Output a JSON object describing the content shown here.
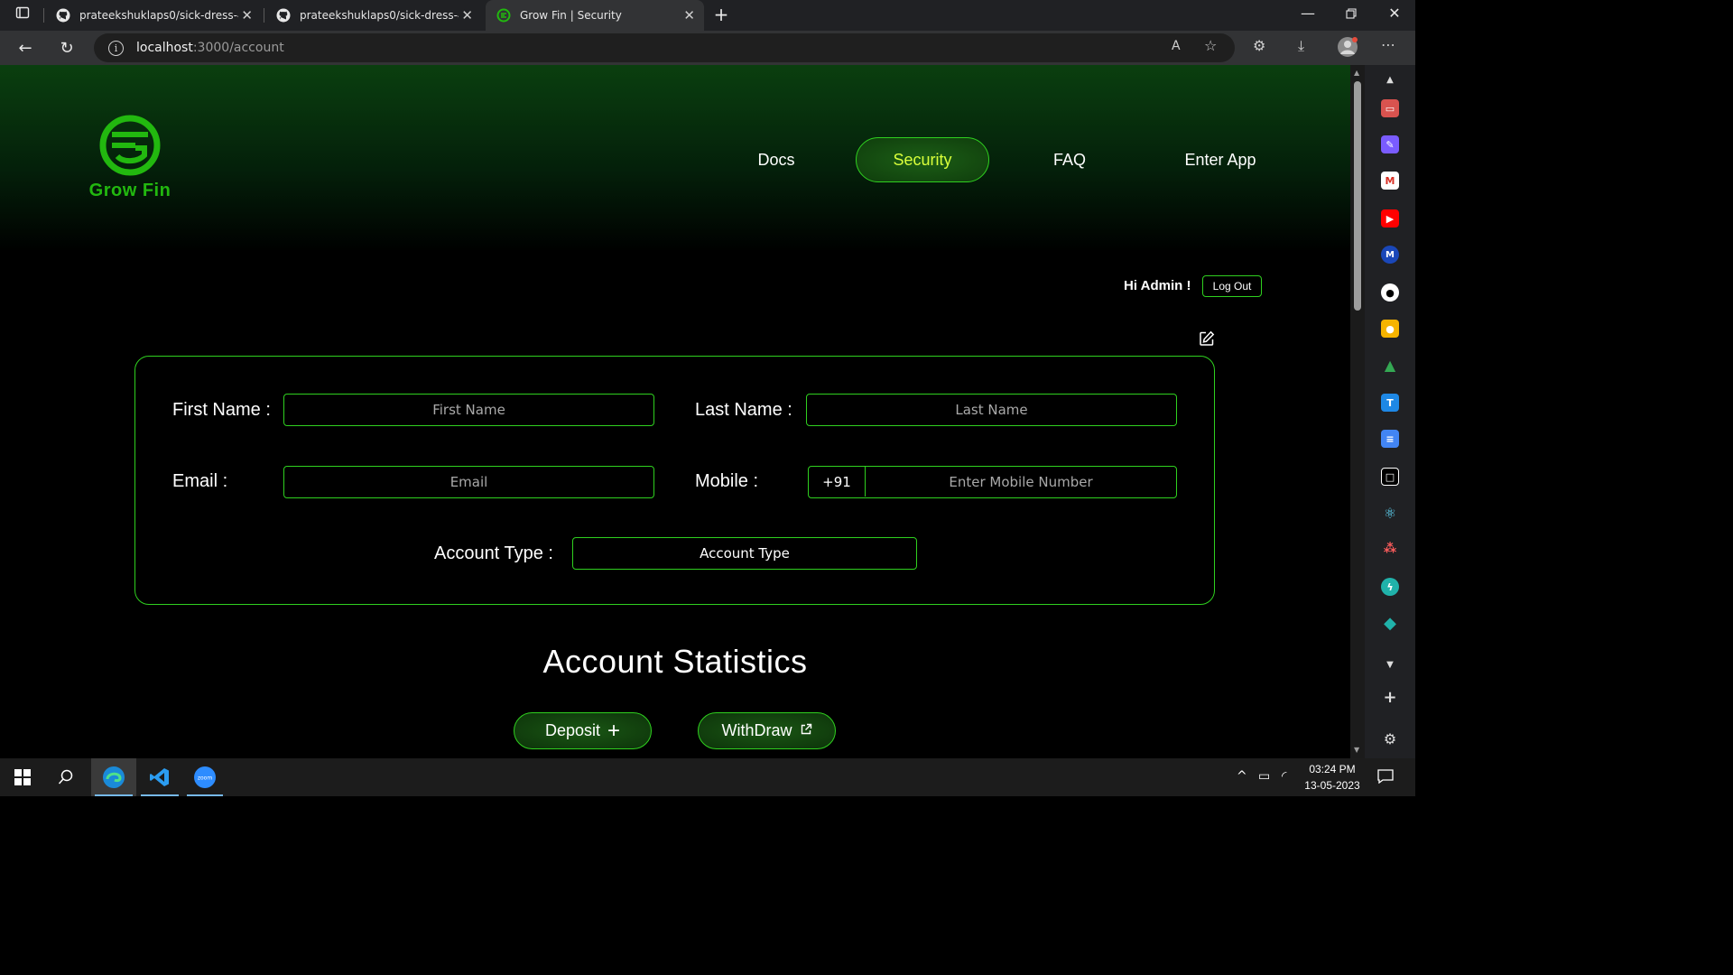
{
  "browser": {
    "tabs": [
      {
        "title": "prateekshuklaps0/sick-dress-493",
        "icon": "github-icon"
      },
      {
        "title": "prateekshuklaps0/sick-dress-493",
        "icon": "github-icon"
      },
      {
        "title": "Grow Fin | Security",
        "icon": "growfin-icon"
      }
    ],
    "url_host": "localhost",
    "url_path": ":3000/account"
  },
  "site": {
    "brand": "Grow Fin",
    "nav": [
      "Docs",
      "Security",
      "FAQ",
      "Enter App"
    ],
    "active_nav": "Security",
    "greeting": "Hi Admin !",
    "logout_label": "Log Out"
  },
  "form": {
    "first_name_label": "First Name :",
    "first_name_placeholder": "First Name",
    "last_name_label": "Last Name :",
    "last_name_placeholder": "Last Name",
    "email_label": "Email :",
    "email_placeholder": "Email",
    "mobile_label": "Mobile :",
    "mobile_prefix": "+91",
    "mobile_placeholder": "Enter Mobile Number",
    "account_type_label": "Account Type :",
    "account_type_value": "Account Type"
  },
  "stats": {
    "title": "Account Statistics",
    "deposit_label": "Deposit",
    "withdraw_label": "WithDraw"
  },
  "taskbar": {
    "time": "03:24 PM",
    "date": "13-05-2023"
  },
  "colors": {
    "accent_green": "#2fd01f",
    "brand_green": "#22b80f",
    "active_nav_text": "#d9ff3a"
  }
}
